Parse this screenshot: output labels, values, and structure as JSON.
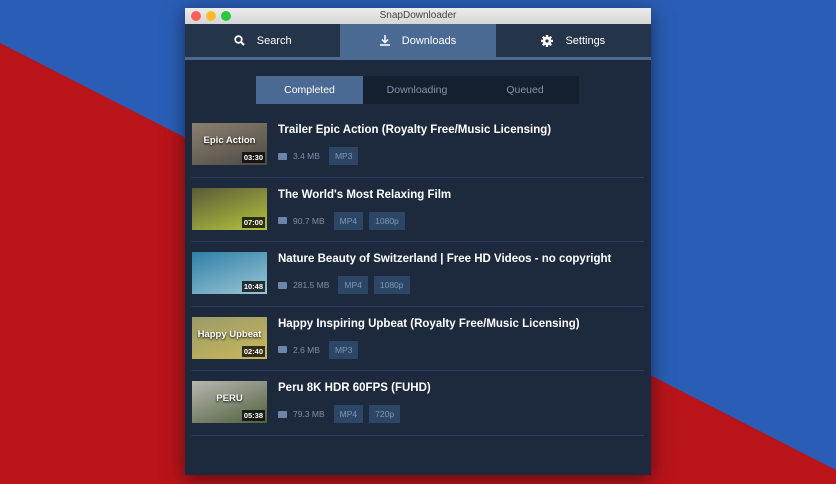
{
  "window": {
    "title": "SnapDownloader"
  },
  "nav": [
    {
      "label": "Search",
      "icon": "search-icon"
    },
    {
      "label": "Downloads",
      "icon": "download-icon"
    },
    {
      "label": "Settings",
      "icon": "gear-icon"
    }
  ],
  "tabs": [
    "Completed",
    "Downloading",
    "Queued"
  ],
  "items": [
    {
      "title": "Trailer Epic Action (Royalty Free/Music Licensing)",
      "thumb_text": "Epic Action",
      "duration": "03:30",
      "size": "3.4 MB",
      "badges": [
        "MP3"
      ],
      "colors": [
        "#8a8070",
        "#4d4a44"
      ]
    },
    {
      "title": "The World's Most Relaxing Film",
      "thumb_text": "",
      "duration": "07:00",
      "size": "90.7 MB",
      "badges": [
        "MP4",
        "1080p"
      ],
      "colors": [
        "#5a5a3a",
        "#b5c43c"
      ]
    },
    {
      "title": "Nature Beauty of Switzerland | Free HD Videos - no copyright",
      "thumb_text": "",
      "duration": "10:48",
      "size": "281.5 MB",
      "badges": [
        "MP4",
        "1080p"
      ],
      "colors": [
        "#2f7fa8",
        "#9bc6d4"
      ]
    },
    {
      "title": "Happy Inspiring Upbeat (Royalty Free/Music Licensing)",
      "thumb_text": "Happy Upbeat",
      "duration": "02:40",
      "size": "2.6 MB",
      "badges": [
        "MP3"
      ],
      "colors": [
        "#9a9a6a",
        "#c9b85a"
      ]
    },
    {
      "title": "Peru 8K HDR 60FPS (FUHD)",
      "thumb_text": "PERU",
      "duration": "05:38",
      "size": "79.3 MB",
      "badges": [
        "MP4",
        "720p"
      ],
      "colors": [
        "#b8b8b0",
        "#4f5f3c"
      ]
    }
  ]
}
